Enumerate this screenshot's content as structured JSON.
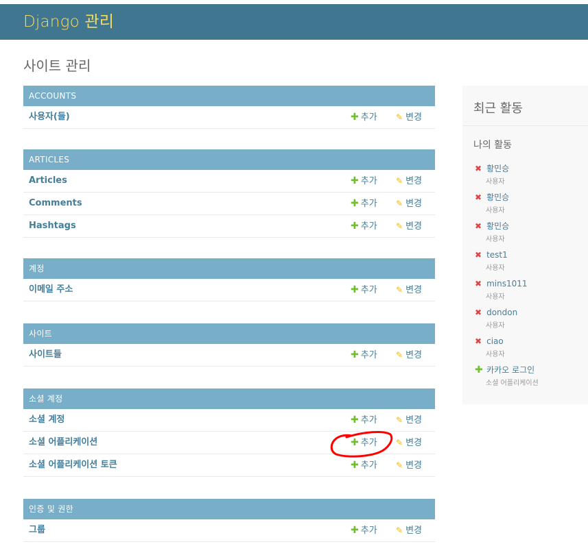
{
  "header": {
    "brand": "Django 관리"
  },
  "page_title": "사이트 관리",
  "modules": [
    {
      "caption": "ACCOUNTS",
      "rows": [
        {
          "name": "사용자(들)",
          "add": "추가",
          "change": "변경"
        }
      ]
    },
    {
      "caption": "ARTICLES",
      "rows": [
        {
          "name": "Articles",
          "add": "추가",
          "change": "변경"
        },
        {
          "name": "Comments",
          "add": "추가",
          "change": "변경"
        },
        {
          "name": "Hashtags",
          "add": "추가",
          "change": "변경"
        }
      ]
    },
    {
      "caption": "계정",
      "rows": [
        {
          "name": "이메일 주소",
          "add": "추가",
          "change": "변경"
        }
      ]
    },
    {
      "caption": "사이트",
      "rows": [
        {
          "name": "사이트들",
          "add": "추가",
          "change": "변경"
        }
      ]
    },
    {
      "caption": "소셜 계정",
      "rows": [
        {
          "name": "소셜 계정",
          "add": "추가",
          "change": "변경"
        },
        {
          "name": "소셜 어플리케이션",
          "add": "추가",
          "change": "변경"
        },
        {
          "name": "소셜 어플리케이션 토큰",
          "add": "추가",
          "change": "변경"
        }
      ]
    },
    {
      "caption": "인증 및 권한",
      "rows": [
        {
          "name": "그룹",
          "add": "추가",
          "change": "변경"
        }
      ]
    }
  ],
  "sidebar": {
    "title": "최근 활동",
    "subtitle": "나의 활동",
    "actions": [
      {
        "type": "deletion",
        "icon": "delete-icon",
        "object": "황민승",
        "content_type": "사용자"
      },
      {
        "type": "deletion",
        "icon": "delete-icon",
        "object": "황민승",
        "content_type": "사용자"
      },
      {
        "type": "deletion",
        "icon": "delete-icon",
        "object": "황민승",
        "content_type": "사용자"
      },
      {
        "type": "deletion",
        "icon": "delete-icon",
        "object": "test1",
        "content_type": "사용자"
      },
      {
        "type": "deletion",
        "icon": "delete-icon",
        "object": "mins1011",
        "content_type": "사용자"
      },
      {
        "type": "deletion",
        "icon": "delete-icon",
        "object": "dondon",
        "content_type": "사용자"
      },
      {
        "type": "deletion",
        "icon": "delete-icon",
        "object": "ciao",
        "content_type": "사용자"
      },
      {
        "type": "addition",
        "icon": "add-icon",
        "object": "카카오 로그인",
        "content_type": "소셜 어플리케이션"
      }
    ]
  },
  "colors": {
    "header_bg": "#417690",
    "brand": "#f5dd5d",
    "caption_bg": "#79aec8",
    "link": "#447e9b",
    "add_icon": "#70bf2b",
    "change_icon": "#efb80b",
    "delete_icon": "#dd4646",
    "annotation": "#ff0000"
  }
}
